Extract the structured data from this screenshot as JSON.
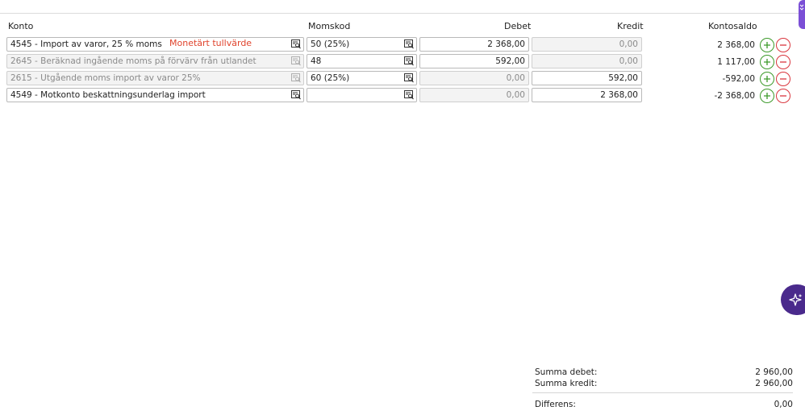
{
  "headers": {
    "konto": "Konto",
    "momskod": "Momskod",
    "debet": "Debet",
    "kredit": "Kredit",
    "kontosaldo": "Kontosaldo"
  },
  "annotation": "Monetärt tullvärde",
  "rows": [
    {
      "konto": "4545 - Import av varor, 25 % moms",
      "momskod": "50 (25%)",
      "debet": "2 368,00",
      "kredit": "0,00",
      "saldo": "2 368,00",
      "konto_readonly": false
    },
    {
      "konto": "2645 - Beräknad ingående moms på förvärv från utlandet",
      "momskod": "48",
      "debet": "592,00",
      "kredit": "0,00",
      "saldo": "1 117,00",
      "konto_readonly": true
    },
    {
      "konto": "2615 - Utgående moms import av varor 25%",
      "momskod": "60 (25%)",
      "debet": "0,00",
      "kredit": "592,00",
      "saldo": "-592,00",
      "konto_readonly": true
    },
    {
      "konto": "4549 - Motkonto beskattningsunderlag import",
      "momskod": "",
      "debet": "0,00",
      "kredit": "2 368,00",
      "saldo": "-2 368,00",
      "konto_readonly": false
    }
  ],
  "summary": {
    "debet_label": "Summa debet:",
    "debet_value": "2 960,00",
    "kredit_label": "Summa kredit:",
    "kredit_value": "2 960,00",
    "diff_label": "Differens:",
    "diff_value": "0,00"
  },
  "icons": {
    "lookup": "lookup-icon",
    "add": "plus-icon",
    "remove": "minus-icon",
    "assistant": "sparkle-icon",
    "side_tab": "chevron-icon"
  },
  "colors": {
    "plus": "#3c9a2a",
    "minus": "#d9363e",
    "annotation": "#e0442d",
    "fab": "#4a2a8c",
    "side_tab": "#7b4fd6"
  }
}
